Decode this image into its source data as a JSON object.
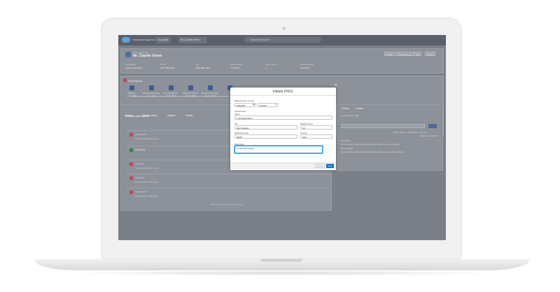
{
  "app": {
    "name": "Insurance Agent C...",
    "tab_1": "Accounts",
    "tab_2": "Mr. Charlie Green",
    "search_placeholder": "Search Salesforce"
  },
  "record": {
    "object": "Person Account",
    "title": "Mr. Charlie Green",
    "buttons": [
      "Follow",
      "Change Owner",
      "Edit",
      "Delete"
    ],
    "fields": [
      {
        "label": "Occupation",
        "value": "Software Engineer"
      },
      {
        "label": "Phone",
        "value": "(415) 555-0132"
      },
      {
        "label": "Cell",
        "value": "(415) 555-0158"
      },
      {
        "label": "Date of Birth",
        "value": "7/14/1985"
      },
      {
        "label": "Policy Count",
        "value": "3"
      },
      {
        "label": "Next Renewal",
        "value": "8/15/2022"
      }
    ]
  },
  "life_events": {
    "title": "Life Events",
    "nodes": [
      {
        "label": "Birthday",
        "date": "Jul 14, 1985"
      },
      {
        "label": "Bill Insurance Renew",
        "date": "Jun 1, 2019"
      },
      {
        "label": "Personal Property",
        "date": "Jan 5, 2018"
      },
      {
        "label": "Married Or Partner",
        "date": "Jun 14, 2018"
      },
      {
        "label": "Moved To Las Vegas",
        "date": "Mar 12, 2019"
      },
      {
        "label": "",
        "date": ""
      }
    ]
  },
  "left_panel": {
    "tabs": [
      "Policies",
      "Relationships",
      "Insights",
      "Details"
    ],
    "section": "Policies and Claims",
    "items": [
      {
        "title": "Homeowner",
        "meta": "Policy Number  Policy Type"
      },
      {
        "title": "Condo (3)",
        "meta": ""
      },
      {
        "title": "Umbrella",
        "meta": "Policy Number  Policy Type"
      },
      {
        "title": "Umbrella",
        "meta": "Policy Number  Policy Type"
      },
      {
        "title": "Homeowner",
        "meta": "Policy Number  Policy Type"
      }
    ],
    "view_all": "Show all Policies  |  Show All Claims"
  },
  "right_panel": {
    "tabs": [
      "Activity",
      "Chatter"
    ],
    "lines": [
      "Log a Call   New Task",
      "Filters: All time • All activities • All types",
      "Refresh • Expand All",
      "Next Steps",
      "No next steps. To get things moving, add a task or set up a meeting.",
      "Past Activities",
      "No past activity. Past meetings and tasks marked as done show up here."
    ]
  },
  "modal": {
    "title": "Initiate FNOL",
    "close": "✕",
    "date_label": "Date and Time of Loss",
    "date_value": "11/9/2020",
    "time_value": "7:04 PM",
    "location_label": "Accident Site",
    "street_label": "Street",
    "street_value": "1 1st Street Street",
    "city_label": "City",
    "city_value": "San Francisco",
    "state_label": "State/Province",
    "state_value": "CA",
    "zip_label": "Zip/Postal Code",
    "zip_value": "94105",
    "country_label": "Country",
    "country_value": "USA",
    "desc_label": "Description",
    "desc_value": "I'm the one involved",
    "cancel": "Cancel",
    "save": "Save"
  },
  "colors": {
    "primary": "#0176d3",
    "focus": "#1b96ff",
    "backdrop": "#7b7f87"
  }
}
